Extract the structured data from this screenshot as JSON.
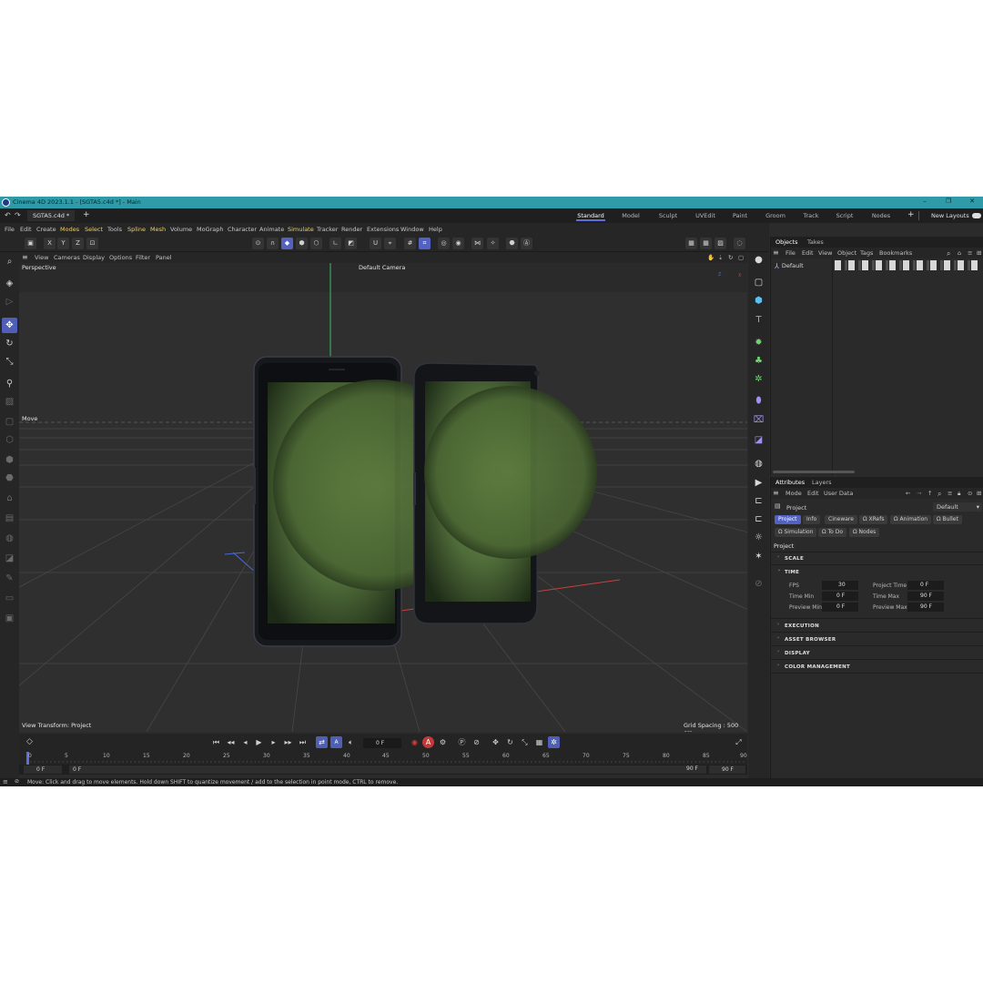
{
  "window": {
    "title": "Cinema 4D 2023.1.1 - [SGTA5.c4d *] - Main",
    "controls": [
      "–",
      "❐",
      "✕"
    ]
  },
  "tabbar": {
    "document_tab": "SGTA5.c4d *",
    "add_tab": "+",
    "layouts": [
      "Standard",
      "Model",
      "Sculpt",
      "UVEdit",
      "Paint",
      "Groom",
      "Track",
      "Script",
      "Nodes"
    ],
    "active_layout": "Standard",
    "new_layouts": "New Layouts"
  },
  "menubar": [
    "File",
    "Edit",
    "Create",
    "Modes",
    "Select",
    "Tools",
    "Spline",
    "Mesh",
    "Volume",
    "MoGraph",
    "Character",
    "Animate",
    "Simulate",
    "Tracker",
    "Render",
    "Extensions",
    "Window",
    "Help"
  ],
  "toolbar": {
    "axes": [
      "X",
      "Y",
      "Z"
    ]
  },
  "viewport": {
    "menu": [
      "View",
      "Cameras",
      "Display",
      "Options",
      "Filter",
      "Panel"
    ],
    "name": "Perspective",
    "camera": "Default Camera",
    "tool_label": "Move",
    "view_transform": "View Transform: Project",
    "grid_spacing": "Grid Spacing : 500 cm",
    "axis_labels": {
      "y": "Y",
      "z": "Z",
      "x": "X"
    }
  },
  "timeline": {
    "current_frame": "0 F",
    "ruler_ticks": [
      "0",
      "5",
      "10",
      "15",
      "20",
      "25",
      "30",
      "35",
      "40",
      "45",
      "50",
      "55",
      "60",
      "65",
      "70",
      "75",
      "80",
      "85",
      "90"
    ],
    "range_start": "0 F",
    "range_start2": "0 F",
    "range_end": "90 F",
    "range_end2": "90 F"
  },
  "status": "Move: Click and drag to move elements. Hold down SHIFT to quantize movement / add to the selection in point mode, CTRL to remove.",
  "objects_panel": {
    "tabs": [
      "Objects",
      "Takes"
    ],
    "menu": [
      "File",
      "Edit",
      "View",
      "Object",
      "Tags",
      "Bookmarks"
    ],
    "item": "Default"
  },
  "attributes_panel": {
    "tabs": [
      "Attributes",
      "Layers"
    ],
    "menu": [
      "Mode",
      "Edit",
      "User Data"
    ],
    "object": "Project",
    "preset": "Default",
    "chips_row1": [
      "Project",
      "Info",
      "Cineware",
      "XRefs",
      "Animation",
      "Bullet"
    ],
    "chips_row2": [
      "Simulation",
      "To Do",
      "Nodes"
    ],
    "heading": "Project",
    "sections": [
      "SCALE",
      "TIME",
      "EXECUTION",
      "ASSET BROWSER",
      "DISPLAY",
      "COLOR MANAGEMENT"
    ],
    "time": {
      "fps_label": "FPS",
      "fps": "30",
      "project_time_label": "Project Time",
      "project_time": "0 F",
      "time_min_label": "Time Min",
      "time_min": "0 F",
      "time_max_label": "Time Max",
      "time_max": "90 F",
      "preview_min_label": "Preview Min",
      "preview_min": "0 F",
      "preview_max_label": "Preview Max",
      "preview_max": "90 F"
    }
  },
  "colors": {
    "title_bar": "#2f9aa8",
    "accent": "#5361c0",
    "background": "#2b2b2b"
  }
}
